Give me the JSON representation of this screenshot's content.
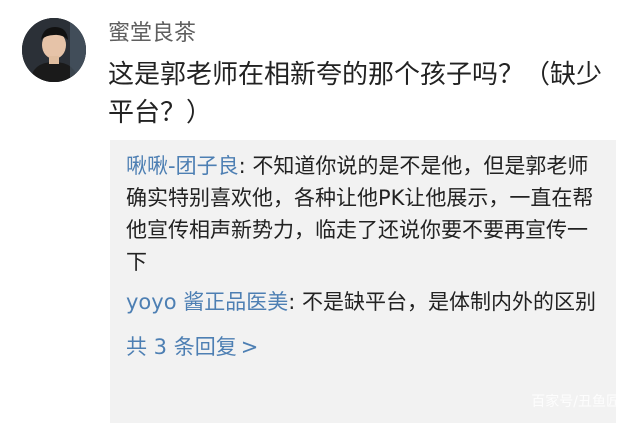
{
  "comment": {
    "username": "蜜堂良茶",
    "text": "这是郭老师在相新夸的那个孩子吗？（缺少平台？）"
  },
  "replies": [
    {
      "user": "啾啾-团子良",
      "separator": ": ",
      "text": "不知道你说的是不是他，但是郭老师确实特别喜欢他，各种让他PK让他展示，一直在帮他宣传相声新势力，临走了还说你要不要再宣传一下"
    },
    {
      "user": "yoyo 酱正品医美",
      "separator": ": ",
      "text": "不是缺平台，是体制内外的区别"
    }
  ],
  "more_replies": {
    "label": "共 3 条回复",
    "arrow": ">"
  },
  "watermark": "百家号/丑鱼匠",
  "icons": {
    "avatar": "user-avatar-photo"
  },
  "colors": {
    "link": "#4d7fb3",
    "reply_bg": "#f2f2f2",
    "text": "#222222",
    "username": "#5f5f5f"
  }
}
